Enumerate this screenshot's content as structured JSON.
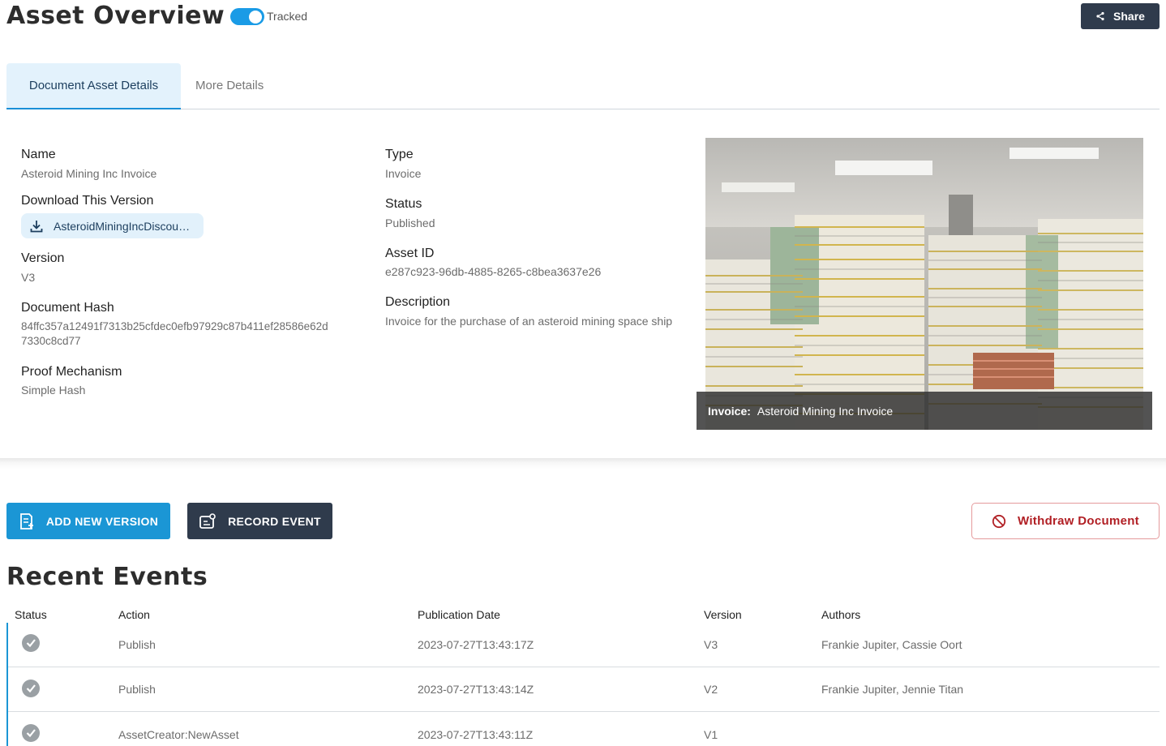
{
  "header": {
    "title": "Asset Overview",
    "toggle_label": "Tracked",
    "toggle_on": true,
    "share_label": "Share"
  },
  "tabs": [
    {
      "label": "Document Asset Details",
      "active": true
    },
    {
      "label": "More Details",
      "active": false
    }
  ],
  "details": {
    "name_label": "Name",
    "name_value": "Asteroid Mining Inc Invoice",
    "download_label": "Download This Version",
    "download_file": "AsteroidMiningIncDiscou…",
    "version_label": "Version",
    "version_value": "V3",
    "hash_label": "Document Hash",
    "hash_value_line1": "84ffc357a12491f7313b25cfdec0efb97929c87b411ef28586e62d",
    "hash_value_line2": "7330c8cd77",
    "proof_label": "Proof Mechanism",
    "proof_value": "Simple Hash",
    "type_label": "Type",
    "type_value": "Invoice",
    "status_label": "Status",
    "status_value": "Published",
    "asset_id_label": "Asset ID",
    "asset_id_value": "e287c923-96db-4885-8265-c8bea3637e26",
    "description_label": "Description",
    "description_value": "Invoice for the purchase of an asteroid mining space ship"
  },
  "image": {
    "caption_label": "Invoice:",
    "caption_value": "Asteroid Mining Inc Invoice"
  },
  "actions": {
    "add_version": "ADD NEW VERSION",
    "record_event": "RECORD EVENT",
    "withdraw": "Withdraw Document"
  },
  "events": {
    "title": "Recent Events",
    "columns": [
      "Status",
      "Action",
      "Publication Date",
      "Version",
      "Authors"
    ],
    "rows": [
      {
        "action": "Publish",
        "date": "2023-07-27T13:43:17Z",
        "version": "V3",
        "authors": "Frankie Jupiter, Cassie Oort"
      },
      {
        "action": "Publish",
        "date": "2023-07-27T13:43:14Z",
        "version": "V2",
        "authors": "Frankie Jupiter, Jennie Titan"
      },
      {
        "action": "AssetCreator:NewAsset",
        "date": "2023-07-27T13:43:11Z",
        "version": "V1",
        "authors": ""
      }
    ]
  },
  "colors": {
    "accent": "#1b96d5",
    "dark": "#2f3b4c",
    "danger": "#b11f24"
  }
}
